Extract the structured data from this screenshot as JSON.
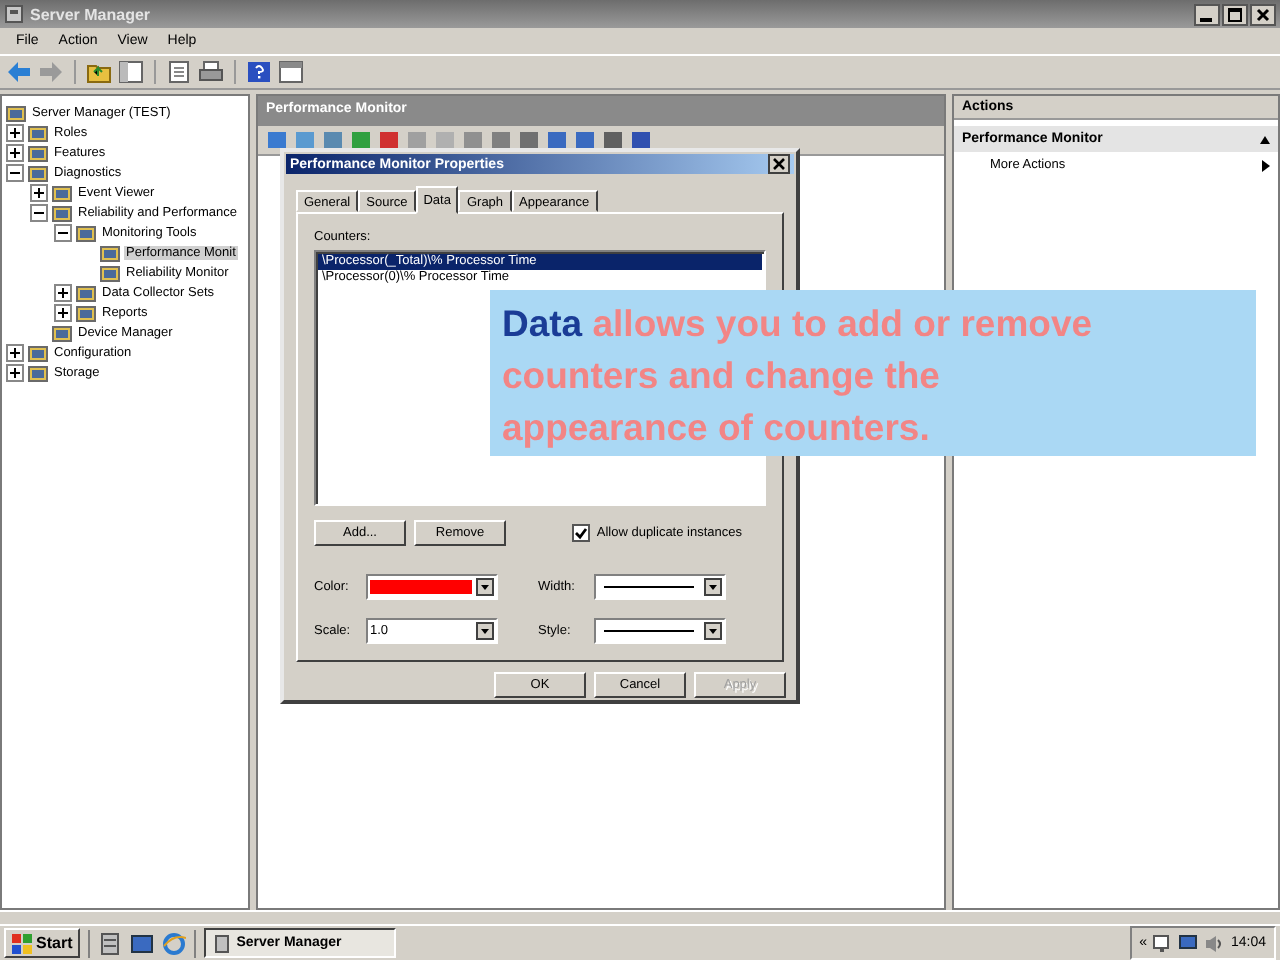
{
  "window": {
    "title": "Server Manager"
  },
  "menu": [
    "File",
    "Action",
    "View",
    "Help"
  ],
  "tree": [
    {
      "label": "Server Manager (TEST)",
      "selected": false,
      "children": [
        {
          "label": "Roles",
          "expanded": false,
          "selected": false
        },
        {
          "label": "Features",
          "expanded": false,
          "selected": false
        },
        {
          "label": "Diagnostics",
          "expanded": true,
          "selected": false,
          "children": [
            {
              "label": "Event Viewer",
              "expanded": false,
              "selected": false
            },
            {
              "label": "Reliability and Performance",
              "expanded": true,
              "selected": false,
              "children": [
                {
                  "label": "Monitoring Tools",
                  "expanded": true,
                  "selected": false,
                  "children": [
                    {
                      "label": "Performance Monit",
                      "selected": true
                    },
                    {
                      "label": "Reliability Monitor",
                      "selected": false
                    }
                  ]
                },
                {
                  "label": "Data Collector Sets",
                  "expanded": false,
                  "selected": false
                },
                {
                  "label": "Reports",
                  "expanded": false,
                  "selected": false
                }
              ]
            },
            {
              "label": "Device Manager",
              "selected": false
            }
          ]
        },
        {
          "label": "Configuration",
          "expanded": false,
          "selected": false
        },
        {
          "label": "Storage",
          "expanded": false,
          "selected": false
        }
      ]
    }
  ],
  "center": {
    "title": "Performance Monitor"
  },
  "actions": {
    "title": "Actions",
    "section": "Performance Monitor",
    "items": [
      "More Actions"
    ]
  },
  "dialog": {
    "title": "Performance Monitor Properties",
    "tabs": [
      {
        "label": "General",
        "selected": false
      },
      {
        "label": "Source",
        "selected": false
      },
      {
        "label": "Data",
        "selected": true
      },
      {
        "label": "Graph",
        "selected": false
      },
      {
        "label": "Appearance",
        "selected": false
      }
    ],
    "counters_label": "Counters:",
    "counters": [
      {
        "label": "\\Processor(_Total)\\% Processor Time",
        "selected": true
      },
      {
        "label": "\\Processor(0)\\% Processor Time",
        "selected": false
      }
    ],
    "add_button": "Add...",
    "remove_button": "Remove",
    "allow_duplicates": {
      "label": "Allow duplicate instances",
      "checked": true
    },
    "color": {
      "label": "Color:",
      "color": "#ff0000"
    },
    "width": {
      "label": "Width:"
    },
    "scale": {
      "label": "Scale:",
      "value": "1.0"
    },
    "style": {
      "label": "Style:"
    },
    "buttons": [
      {
        "label": "OK",
        "disabled": false
      },
      {
        "label": "Cancel",
        "disabled": false
      },
      {
        "label": "Apply",
        "disabled": true
      }
    ]
  },
  "callout": {
    "highlight": "Data",
    "text": "allows you to add or remove counters and change the appearance of counters."
  },
  "taskbar": {
    "start": "Start",
    "task": "Server Manager",
    "tray_toggle": "«",
    "clock": "14:04"
  }
}
